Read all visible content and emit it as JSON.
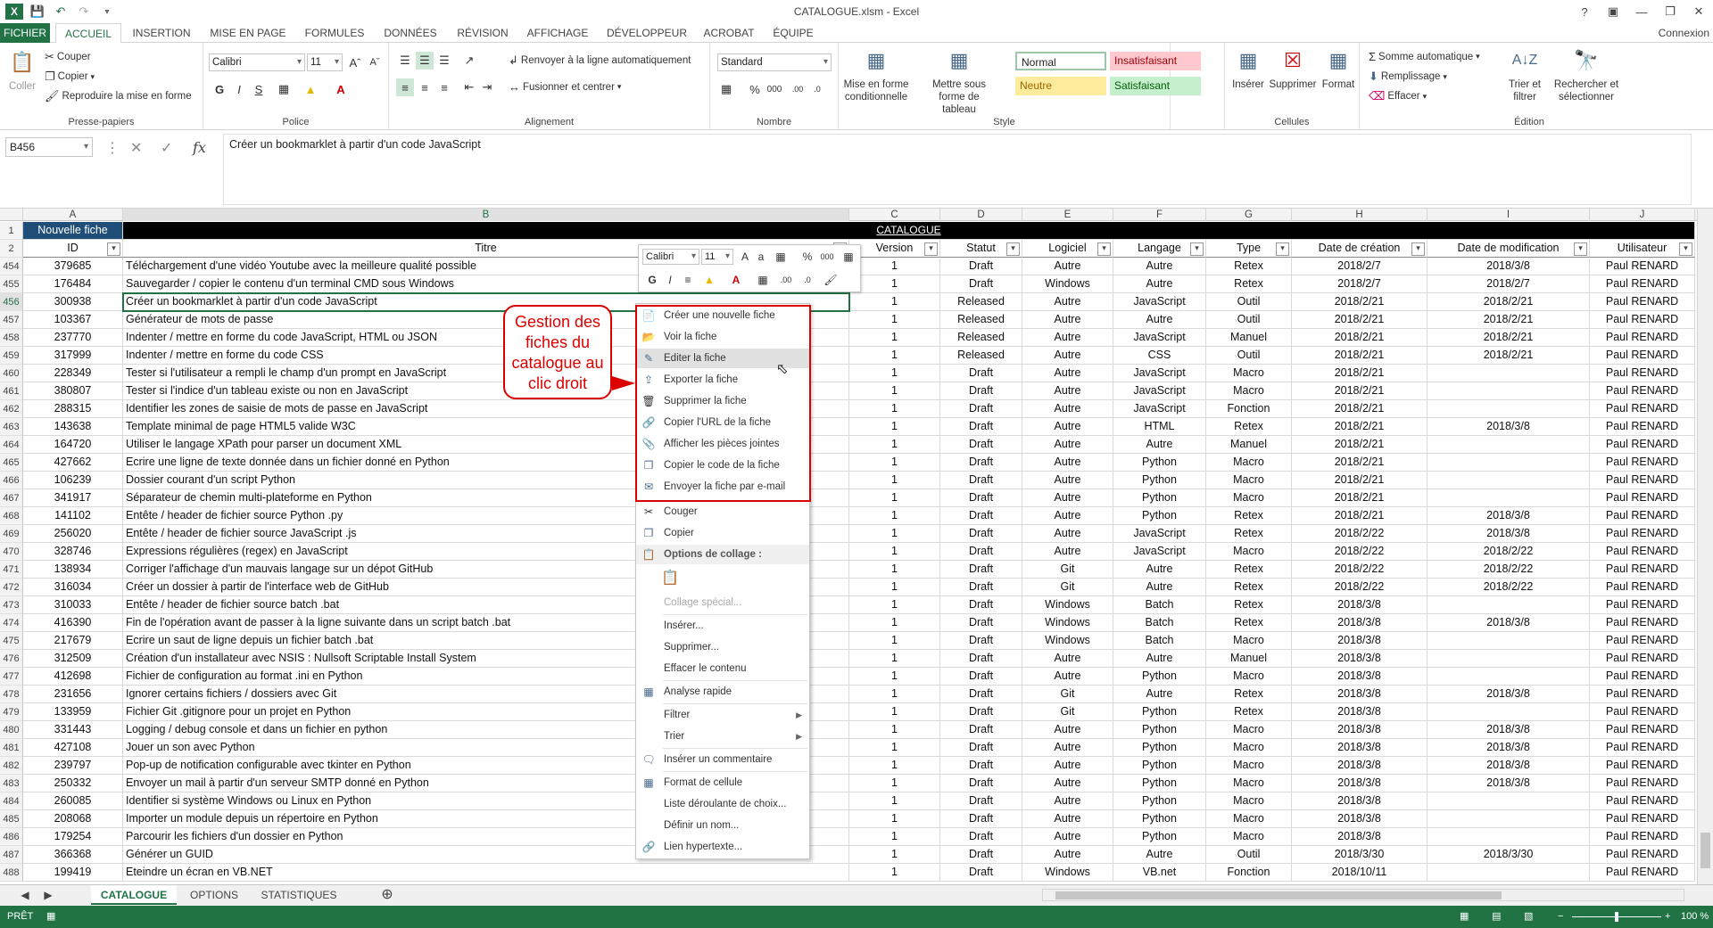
{
  "app": {
    "title": "CATALOGUE.xlsm - Excel",
    "account": "Connexion"
  },
  "tabs": [
    "FICHIER",
    "ACCUEIL",
    "INSERTION",
    "MISE EN PAGE",
    "FORMULES",
    "DONNÉES",
    "RÉVISION",
    "AFFICHAGE",
    "DÉVELOPPEUR",
    "ACROBAT",
    "ÉQUIPE"
  ],
  "ribbon": {
    "clipboard": {
      "paste": "Coller",
      "cut": "Couper",
      "copy": "Copier",
      "format_painter": "Reproduire la mise en forme",
      "label": "Presse-papiers"
    },
    "font": {
      "name": "Calibri",
      "size": "11",
      "label": "Police",
      "bold": "G",
      "italic": "I",
      "underline": "S"
    },
    "alignment": {
      "wrap": "Renvoyer à la ligne automatiquement",
      "merge": "Fusionner et centrer",
      "label": "Alignement"
    },
    "number": {
      "format": "Standard",
      "label": "Nombre",
      "percent": "%",
      "thousands": "000"
    },
    "styles": {
      "conditional": "Mise en forme conditionnelle",
      "as_table": "Mettre sous forme de tableau",
      "normal": "Normal",
      "bad": "Insatisfaisant",
      "neutral": "Neutre",
      "good": "Satisfaisant",
      "label": "Style"
    },
    "cells": {
      "insert": "Insérer",
      "delete": "Supprimer",
      "format": "Format",
      "label": "Cellules"
    },
    "editing": {
      "autosum": "Somme automatique",
      "fill": "Remplissage",
      "clear": "Effacer",
      "sort": "Trier et filtrer",
      "find": "Rechercher et sélectionner",
      "label": "Édition"
    }
  },
  "formula_bar": {
    "name_box": "B456",
    "content": "Créer un bookmarklet à partir d'un code JavaScript",
    "fx": "fx"
  },
  "columns": [
    "A",
    "B",
    "C",
    "D",
    "E",
    "F",
    "G",
    "H",
    "I",
    "J"
  ],
  "row1": {
    "num": "1",
    "new_fiche": "Nouvelle fiche",
    "catalogue": "CATALOGUE"
  },
  "headers": {
    "num": "2",
    "cells": [
      "ID",
      "Titre",
      "Version",
      "Statut",
      "Logiciel",
      "Langage",
      "Type",
      "Date de création",
      "Date de modification",
      "Utilisateur"
    ]
  },
  "rows": [
    [
      "454",
      "379685",
      "Téléchargement d'une vidéo Youtube avec la meilleure qualité possible",
      "1",
      "Draft",
      "Autre",
      "Autre",
      "Retex",
      "2018/2/7",
      "2018/3/8",
      "Paul RENARD"
    ],
    [
      "455",
      "176484",
      "Sauvegarder / copier le contenu d'un terminal CMD sous Windows",
      "1",
      "Draft",
      "Windows",
      "Autre",
      "Retex",
      "2018/2/7",
      "2018/2/7",
      "Paul RENARD"
    ],
    [
      "456",
      "300938",
      "Créer un bookmarklet à partir d'un code JavaScript",
      "1",
      "Released",
      "Autre",
      "JavaScript",
      "Outil",
      "2018/2/21",
      "2018/2/21",
      "Paul RENARD"
    ],
    [
      "457",
      "103367",
      "Générateur de mots de passe",
      "1",
      "Released",
      "Autre",
      "Autre",
      "Outil",
      "2018/2/21",
      "2018/2/21",
      "Paul RENARD"
    ],
    [
      "458",
      "237770",
      "Indenter / mettre en forme du code JavaScript, HTML ou JSON",
      "1",
      "Released",
      "Autre",
      "JavaScript",
      "Manuel",
      "2018/2/21",
      "2018/2/21",
      "Paul RENARD"
    ],
    [
      "459",
      "317999",
      "Indenter / mettre en forme du code CSS",
      "1",
      "Released",
      "Autre",
      "CSS",
      "Outil",
      "2018/2/21",
      "2018/2/21",
      "Paul RENARD"
    ],
    [
      "460",
      "228349",
      "Tester si l'utilisateur a rempli le champ d'un prompt en JavaScript",
      "1",
      "Draft",
      "Autre",
      "JavaScript",
      "Macro",
      "2018/2/21",
      "",
      "Paul RENARD"
    ],
    [
      "461",
      "380807",
      "Tester si l'indice d'un tableau existe ou non en JavaScript",
      "1",
      "Draft",
      "Autre",
      "JavaScript",
      "Macro",
      "2018/2/21",
      "",
      "Paul RENARD"
    ],
    [
      "462",
      "288315",
      "Identifier les zones de saisie de mots de passe en JavaScript",
      "1",
      "Draft",
      "Autre",
      "JavaScript",
      "Fonction",
      "2018/2/21",
      "",
      "Paul RENARD"
    ],
    [
      "463",
      "143638",
      "Template minimal de page HTML5 valide W3C",
      "1",
      "Draft",
      "Autre",
      "HTML",
      "Retex",
      "2018/2/21",
      "2018/3/8",
      "Paul RENARD"
    ],
    [
      "464",
      "164720",
      "Utiliser le langage XPath pour parser un document XML",
      "1",
      "Draft",
      "Autre",
      "Autre",
      "Manuel",
      "2018/2/21",
      "",
      "Paul RENARD"
    ],
    [
      "465",
      "427662",
      "Ecrire une ligne de texte donnée dans un fichier donné en Python",
      "1",
      "Draft",
      "Autre",
      "Python",
      "Macro",
      "2018/2/21",
      "",
      "Paul RENARD"
    ],
    [
      "466",
      "106239",
      "Dossier courant d'un script Python",
      "1",
      "Draft",
      "Autre",
      "Python",
      "Macro",
      "2018/2/21",
      "",
      "Paul RENARD"
    ],
    [
      "467",
      "341917",
      "Séparateur de chemin multi-plateforme en Python",
      "1",
      "Draft",
      "Autre",
      "Python",
      "Macro",
      "2018/2/21",
      "",
      "Paul RENARD"
    ],
    [
      "468",
      "141102",
      "Entête / header de fichier source Python .py",
      "1",
      "Draft",
      "Autre",
      "Python",
      "Retex",
      "2018/2/21",
      "2018/3/8",
      "Paul RENARD"
    ],
    [
      "469",
      "256020",
      "Entête / header de fichier source JavaScript .js",
      "1",
      "Draft",
      "Autre",
      "JavaScript",
      "Retex",
      "2018/2/22",
      "2018/3/8",
      "Paul RENARD"
    ],
    [
      "470",
      "328746",
      "Expressions régulières (regex) en JavaScript",
      "1",
      "Draft",
      "Autre",
      "JavaScript",
      "Macro",
      "2018/2/22",
      "2018/2/22",
      "Paul RENARD"
    ],
    [
      "471",
      "138934",
      "Corriger l'affichage d'un mauvais langage sur un dépot GitHub",
      "1",
      "Draft",
      "Git",
      "Autre",
      "Retex",
      "2018/2/22",
      "2018/2/22",
      "Paul RENARD"
    ],
    [
      "472",
      "316034",
      "Créer un dossier à partir de l'interface web de GitHub",
      "1",
      "Draft",
      "Git",
      "Autre",
      "Retex",
      "2018/2/22",
      "2018/2/22",
      "Paul RENARD"
    ],
    [
      "473",
      "310033",
      "Entête / header de fichier source batch .bat",
      "1",
      "Draft",
      "Windows",
      "Batch",
      "Retex",
      "2018/3/8",
      "",
      "Paul RENARD"
    ],
    [
      "474",
      "416390",
      "Fin de l'opération avant de passer à la ligne suivante dans un script batch .bat",
      "1",
      "Draft",
      "Windows",
      "Batch",
      "Retex",
      "2018/3/8",
      "2018/3/8",
      "Paul RENARD"
    ],
    [
      "475",
      "217679",
      "Ecrire un saut de ligne depuis un fichier batch .bat",
      "1",
      "Draft",
      "Windows",
      "Batch",
      "Macro",
      "2018/3/8",
      "",
      "Paul RENARD"
    ],
    [
      "476",
      "312509",
      "Création d'un installateur avec NSIS : Nullsoft Scriptable Install System",
      "1",
      "Draft",
      "Autre",
      "Autre",
      "Manuel",
      "2018/3/8",
      "",
      "Paul RENARD"
    ],
    [
      "477",
      "412698",
      "Fichier de configuration au format .ini en Python",
      "1",
      "Draft",
      "Autre",
      "Python",
      "Macro",
      "2018/3/8",
      "",
      "Paul RENARD"
    ],
    [
      "478",
      "231656",
      "Ignorer certains fichiers / dossiers avec Git",
      "1",
      "Draft",
      "Git",
      "Autre",
      "Retex",
      "2018/3/8",
      "2018/3/8",
      "Paul RENARD"
    ],
    [
      "479",
      "133959",
      "Fichier Git .gitignore pour un projet en Python",
      "1",
      "Draft",
      "Git",
      "Python",
      "Retex",
      "2018/3/8",
      "",
      "Paul RENARD"
    ],
    [
      "480",
      "331443",
      "Logging / debug console et dans un fichier en python",
      "1",
      "Draft",
      "Autre",
      "Python",
      "Macro",
      "2018/3/8",
      "2018/3/8",
      "Paul RENARD"
    ],
    [
      "481",
      "427108",
      "Jouer un son avec Python",
      "1",
      "Draft",
      "Autre",
      "Python",
      "Macro",
      "2018/3/8",
      "2018/3/8",
      "Paul RENARD"
    ],
    [
      "482",
      "239797",
      "Pop-up de notification configurable avec tkinter en Python",
      "1",
      "Draft",
      "Autre",
      "Python",
      "Macro",
      "2018/3/8",
      "2018/3/8",
      "Paul RENARD"
    ],
    [
      "483",
      "250332",
      "Envoyer un mail à partir d'un serveur SMTP donné en Python",
      "1",
      "Draft",
      "Autre",
      "Python",
      "Macro",
      "2018/3/8",
      "2018/3/8",
      "Paul RENARD"
    ],
    [
      "484",
      "260085",
      "Identifier si système Windows ou Linux en Python",
      "1",
      "Draft",
      "Autre",
      "Python",
      "Macro",
      "2018/3/8",
      "",
      "Paul RENARD"
    ],
    [
      "485",
      "208068",
      "Importer un module depuis un répertoire en Python",
      "1",
      "Draft",
      "Autre",
      "Python",
      "Macro",
      "2018/3/8",
      "",
      "Paul RENARD"
    ],
    [
      "486",
      "179254",
      "Parcourir les fichiers d'un dossier en Python",
      "1",
      "Draft",
      "Autre",
      "Python",
      "Macro",
      "2018/3/8",
      "",
      "Paul RENARD"
    ],
    [
      "487",
      "366368",
      "Générer un GUID",
      "1",
      "Draft",
      "Autre",
      "Autre",
      "Outil",
      "2018/3/30",
      "2018/3/30",
      "Paul RENARD"
    ],
    [
      "488",
      "199419",
      "Eteindre un écran en VB.NET",
      "1",
      "Draft",
      "Windows",
      "VB.net",
      "Fonction",
      "2018/10/11",
      "",
      "Paul RENARD"
    ]
  ],
  "mini_toolbar": {
    "font": "Calibri",
    "size": "11"
  },
  "context_menu": {
    "custom": [
      "Créer une nouvelle fiche",
      "Voir la fiche",
      "Editer la fiche",
      "Exporter la fiche",
      "Supprimer la fiche",
      "Copier l'URL de la fiche",
      "Afficher les pièces jointes",
      "Copier le code de la fiche",
      "Envoyer la fiche par e-mail"
    ],
    "cut": "Couger",
    "copy": "Copier",
    "paste_options": "Options de collage :",
    "paste_special": "Collage spécial...",
    "insert": "Insérer...",
    "delete": "Supprimer...",
    "clear": "Effacer le contenu",
    "quick_analysis": "Analyse rapide",
    "filter": "Filtrer",
    "sort": "Trier",
    "comment": "Insérer un commentaire",
    "format_cells": "Format de cellule",
    "dropdown": "Liste déroulante de choix...",
    "define_name": "Définir un nom...",
    "hyperlink": "Lien hypertexte..."
  },
  "callout": "Gestion des fiches du catalogue au clic droit",
  "sheets": [
    "CATALOGUE",
    "OPTIONS",
    "STATISTIQUES"
  ],
  "status": {
    "ready": "PRÊT",
    "zoom": "100 %"
  },
  "colors": {
    "excel_green": "#217346",
    "header_blue": "#1f4e78",
    "callout_red": "#dd0000"
  }
}
